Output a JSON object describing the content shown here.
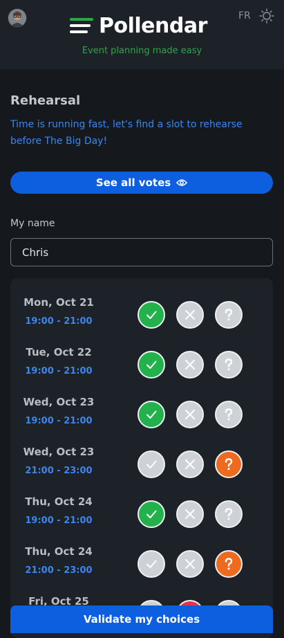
{
  "header": {
    "brand_name": "Pollendar",
    "tagline": "Event planning made easy",
    "language": "FR",
    "brand_colors": [
      "#ffffff",
      "#2aa84a",
      "#1f6e2e"
    ],
    "avatar_icon": "user-avatar",
    "theme_icon": "sun-icon"
  },
  "event": {
    "title": "Rehearsal",
    "description": "Time is running fast, let's find a slot to rehearse before The Big Day!"
  },
  "actions": {
    "see_votes_label": "See all votes",
    "see_votes_icon": "eye-icon",
    "validate_label": "Validate my choices"
  },
  "form": {
    "name_label": "My name",
    "name_value": "Chris"
  },
  "colors": {
    "accent_blue": "#0d5fe0",
    "time_blue": "#3b86f0",
    "yes_green": "#23b14b",
    "no_red": "#e2344b",
    "maybe_orange": "#ee6a1f",
    "neutral_grey": "#ced2d7"
  },
  "slots": [
    {
      "date": "Mon, Oct 21",
      "time": "19:00 - 21:00",
      "selected": "yes"
    },
    {
      "date": "Tue, Oct 22",
      "time": "19:00 - 21:00",
      "selected": "yes"
    },
    {
      "date": "Wed, Oct 23",
      "time": "19:00 - 21:00",
      "selected": "yes"
    },
    {
      "date": "Wed, Oct 23",
      "time": "21:00 - 23:00",
      "selected": "maybe"
    },
    {
      "date": "Thu, Oct 24",
      "time": "19:00 - 21:00",
      "selected": "yes"
    },
    {
      "date": "Thu, Oct 24",
      "time": "21:00 - 23:00",
      "selected": "maybe"
    },
    {
      "date": "Fri, Oct 25",
      "time": "",
      "selected": "no"
    }
  ]
}
